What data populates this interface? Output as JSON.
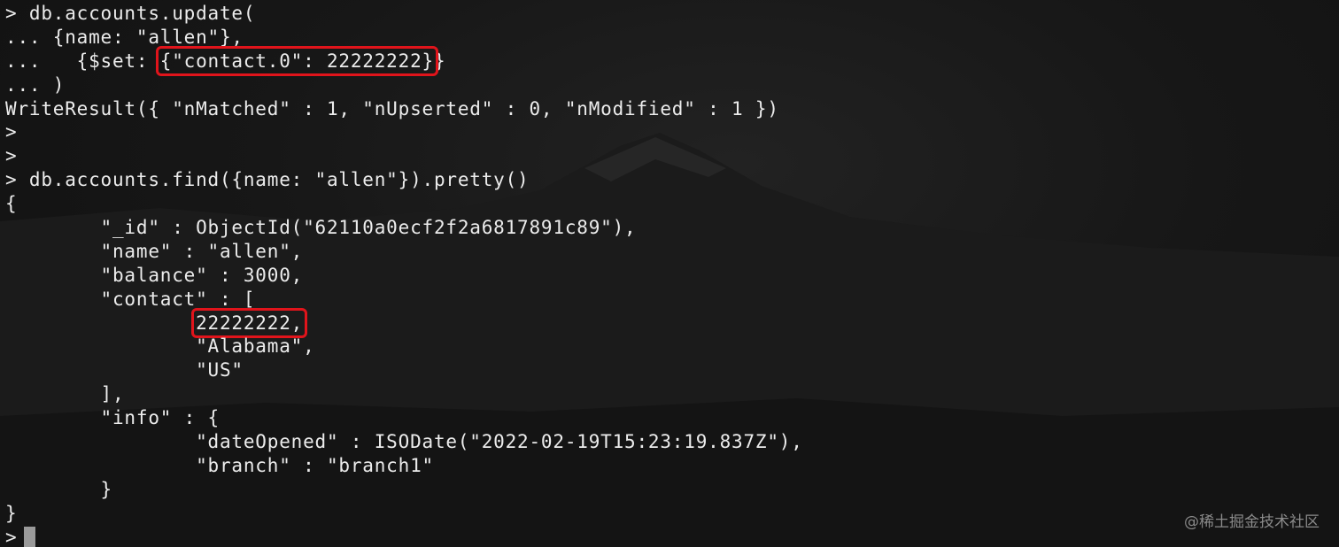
{
  "terminal": {
    "lines": [
      {
        "text": "> db.accounts.update("
      },
      {
        "text": "... {name: \"allen\"},"
      },
      {
        "pre": "...   {$set: ",
        "hl": "{\"contact.0\": 22222222}",
        "post": "}"
      },
      {
        "text": "... )"
      },
      {
        "text": "WriteResult({ \"nMatched\" : 1, \"nUpserted\" : 0, \"nModified\" : 1 })"
      },
      {
        "text": ">"
      },
      {
        "text": ">"
      },
      {
        "text": "> db.accounts.find({name: \"allen\"}).pretty()"
      },
      {
        "text": "{"
      },
      {
        "text": "        \"_id\" : ObjectId(\"62110a0ecf2f2a6817891c89\"),"
      },
      {
        "text": "        \"name\" : \"allen\","
      },
      {
        "text": "        \"balance\" : 3000,"
      },
      {
        "text": "        \"contact\" : ["
      },
      {
        "pre": "                ",
        "hl": "22222222,",
        "post": ""
      },
      {
        "text": "                \"Alabama\","
      },
      {
        "text": "                \"US\""
      },
      {
        "text": "        ],"
      },
      {
        "text": "        \"info\" : {"
      },
      {
        "text": "                \"dateOpened\" : ISODate(\"2022-02-19T15:23:19.837Z\"),"
      },
      {
        "text": "                \"branch\" : \"branch1\""
      },
      {
        "text": "        }"
      },
      {
        "text": "}"
      }
    ],
    "prompt": ">"
  },
  "watermark": "@稀土掘金技术社区"
}
